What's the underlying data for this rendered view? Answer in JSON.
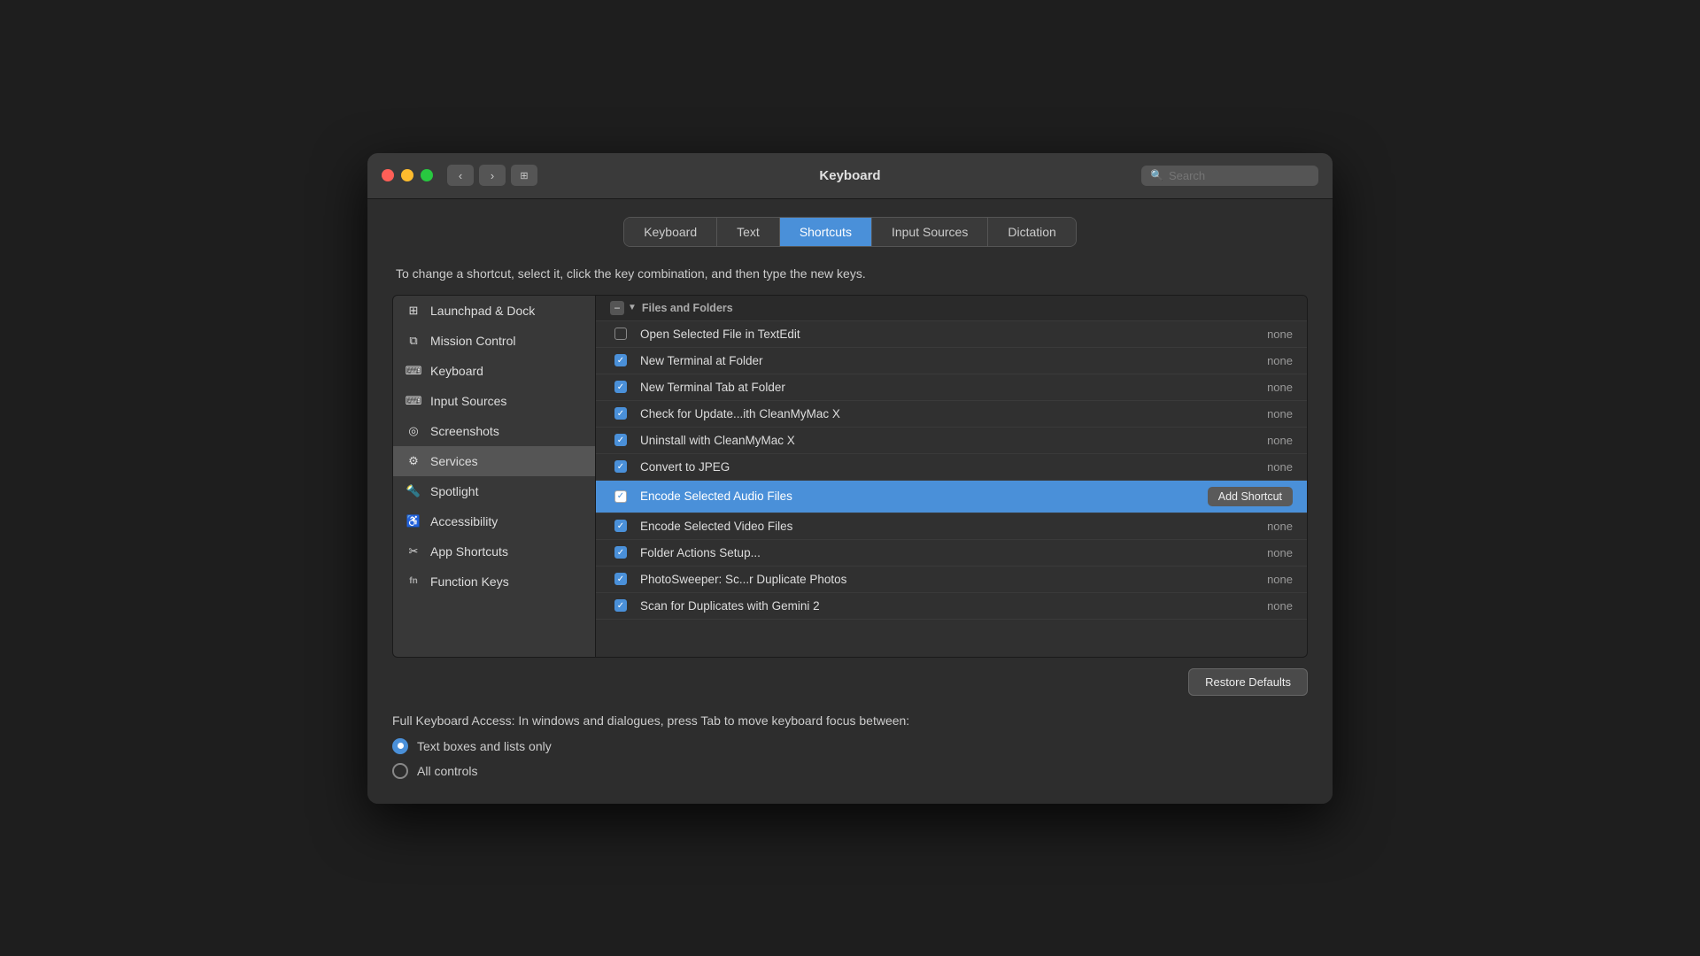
{
  "window": {
    "title": "Keyboard"
  },
  "search": {
    "placeholder": "Search"
  },
  "tabs": [
    {
      "id": "keyboard",
      "label": "Keyboard",
      "active": false
    },
    {
      "id": "text",
      "label": "Text",
      "active": false
    },
    {
      "id": "shortcuts",
      "label": "Shortcuts",
      "active": true
    },
    {
      "id": "input-sources",
      "label": "Input Sources",
      "active": false
    },
    {
      "id": "dictation",
      "label": "Dictation",
      "active": false
    }
  ],
  "instruction": "To change a shortcut, select it, click the key combination, and then type the new keys.",
  "sidebar": {
    "items": [
      {
        "id": "launchpad",
        "label": "Launchpad & Dock",
        "icon": "grid"
      },
      {
        "id": "mission-control",
        "label": "Mission Control",
        "icon": "mission"
      },
      {
        "id": "keyboard",
        "label": "Keyboard",
        "icon": "keyboard"
      },
      {
        "id": "input-sources",
        "label": "Input Sources",
        "icon": "input"
      },
      {
        "id": "screenshots",
        "label": "Screenshots",
        "icon": "screenshot"
      },
      {
        "id": "services",
        "label": "Services",
        "icon": "gear",
        "active": true
      },
      {
        "id": "spotlight",
        "label": "Spotlight",
        "icon": "spotlight"
      },
      {
        "id": "accessibility",
        "label": "Accessibility",
        "icon": "accessibility"
      },
      {
        "id": "app-shortcuts",
        "label": "App Shortcuts",
        "icon": "app"
      },
      {
        "id": "function-keys",
        "label": "Function Keys",
        "icon": "fn"
      }
    ]
  },
  "shortcut_group": {
    "header": "Files and Folders",
    "items": [
      {
        "id": "open-textedit",
        "label": "Open Selected File in TextEdit",
        "key": "none",
        "checked": false
      },
      {
        "id": "new-terminal",
        "label": "New Terminal at Folder",
        "key": "none",
        "checked": true
      },
      {
        "id": "new-terminal-tab",
        "label": "New Terminal Tab at Folder",
        "key": "none",
        "checked": true
      },
      {
        "id": "check-update",
        "label": "Check for Update...ith CleanMyMac X",
        "key": "none",
        "checked": true
      },
      {
        "id": "uninstall-clean",
        "label": "Uninstall with CleanMyMac X",
        "key": "none",
        "checked": true
      },
      {
        "id": "convert-jpeg",
        "label": "Convert to JPEG",
        "key": "none",
        "checked": true
      },
      {
        "id": "encode-audio",
        "label": "Encode Selected Audio Files",
        "key": "Add Shortcut",
        "checked": true,
        "selected": true
      },
      {
        "id": "encode-video",
        "label": "Encode Selected Video Files",
        "key": "none",
        "checked": true
      },
      {
        "id": "folder-actions",
        "label": "Folder Actions Setup...",
        "key": "none",
        "checked": true
      },
      {
        "id": "photosweeper",
        "label": "PhotoSweeper: Sc...r Duplicate Photos",
        "key": "none",
        "checked": true
      },
      {
        "id": "scan-duplicates",
        "label": "Scan for Duplicates with Gemini 2",
        "key": "none",
        "checked": true
      }
    ]
  },
  "buttons": {
    "restore_defaults": "Restore Defaults",
    "add_shortcut": "Add Shortcut"
  },
  "keyboard_access": {
    "label": "Full Keyboard Access: In windows and dialogues, press Tab to move keyboard focus between:",
    "options": [
      {
        "id": "text-boxes",
        "label": "Text boxes and lists only",
        "selected": true
      },
      {
        "id": "all-controls",
        "label": "All controls",
        "selected": false
      }
    ]
  }
}
